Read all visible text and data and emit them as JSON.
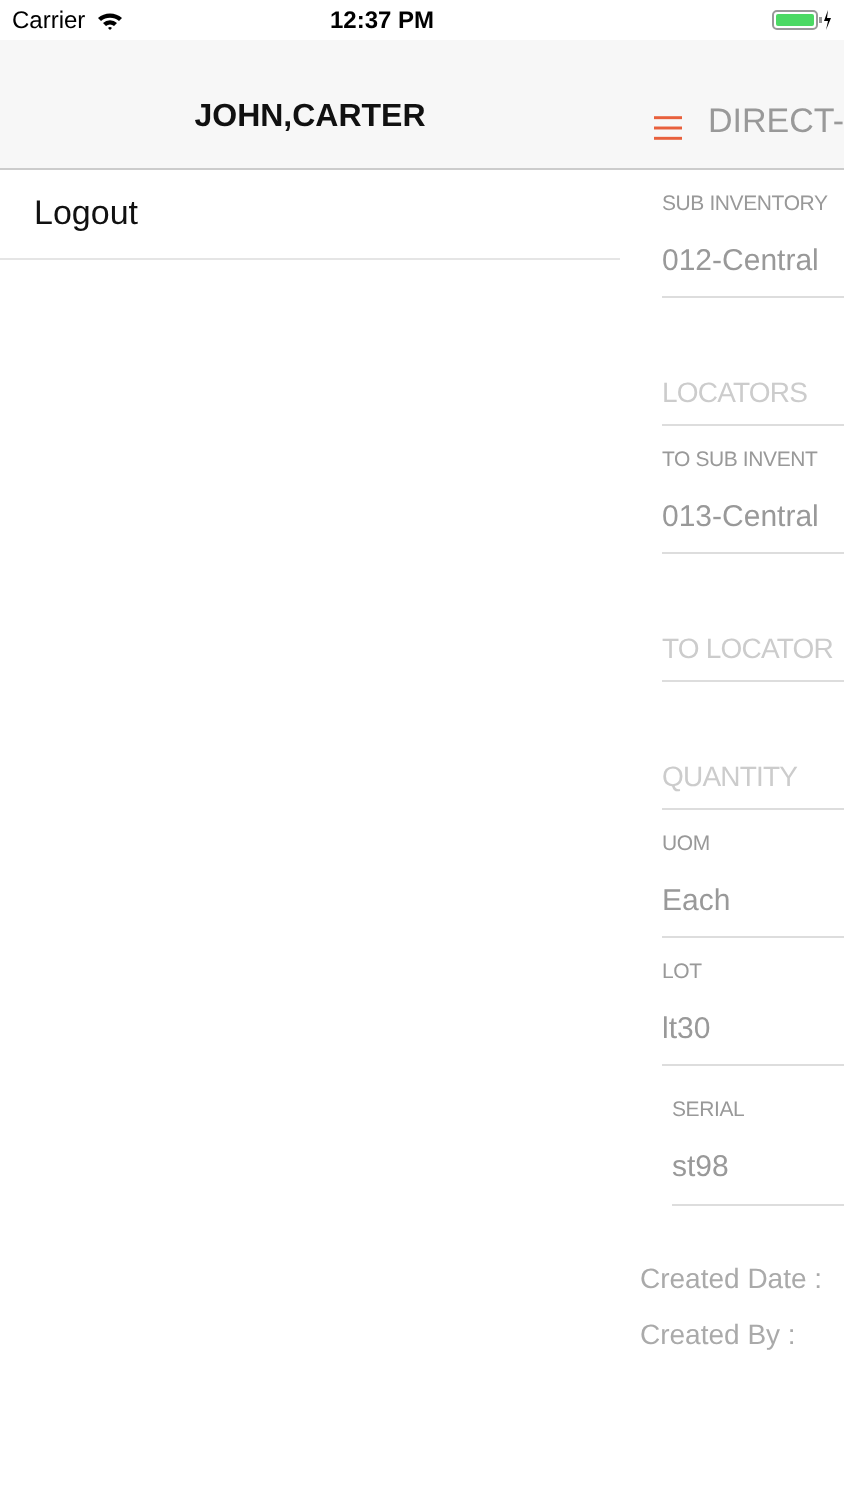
{
  "status_bar": {
    "carrier": "Carrier",
    "time": "12:37 PM"
  },
  "drawer": {
    "title": "JOHN,CARTER",
    "items": [
      {
        "label": "Logout"
      }
    ]
  },
  "screen": {
    "title": "DIRECT-",
    "fields": [
      {
        "kind": "labeled",
        "label": "SUB INVENTORY",
        "value": "012-Central"
      },
      {
        "kind": "placeholder",
        "placeholder": "LOCATORS"
      },
      {
        "kind": "labeled",
        "label": "TO SUB INVENT",
        "value": "013-Central"
      },
      {
        "kind": "placeholder",
        "placeholder": "TO LOCATOR"
      },
      {
        "kind": "placeholder",
        "placeholder": "QUANTITY"
      },
      {
        "kind": "labeled",
        "label": "UOM",
        "value": "Each"
      },
      {
        "kind": "labeled",
        "label": "LOT",
        "value": "lt30"
      },
      {
        "kind": "nested",
        "label": "SERIAL",
        "value": "st98"
      }
    ],
    "info": [
      "Created Date :",
      "Created By :"
    ]
  }
}
